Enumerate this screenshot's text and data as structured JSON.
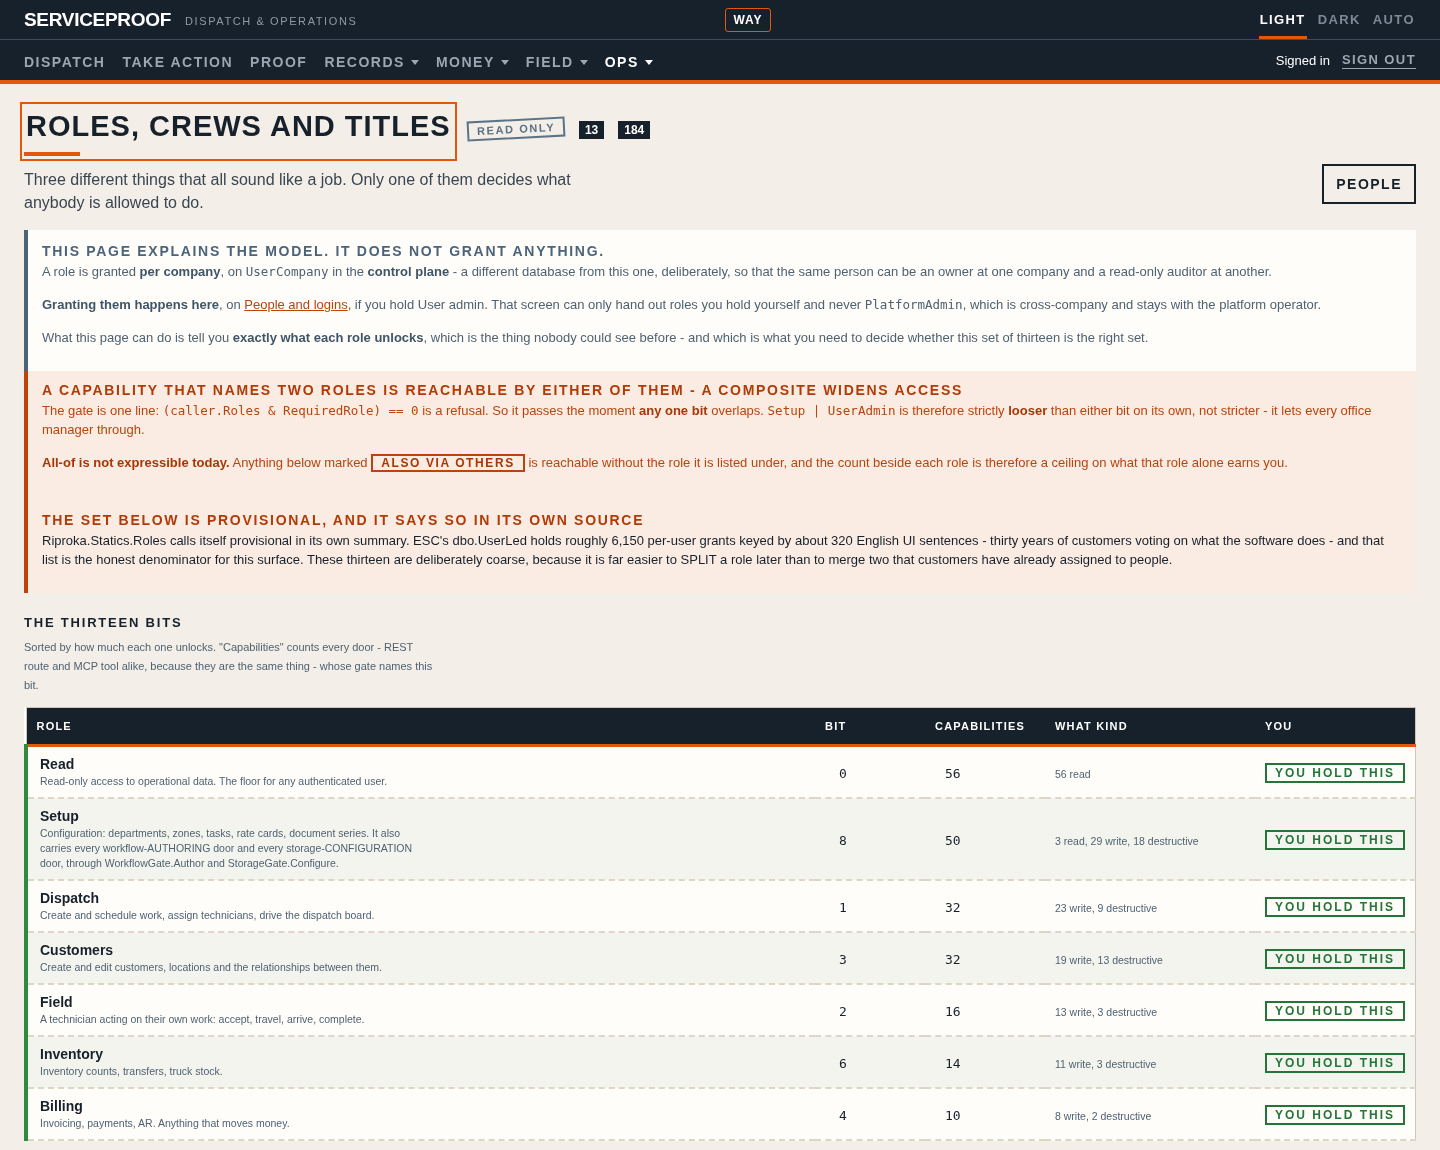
{
  "header": {
    "brand": "SERVICEPROOF",
    "tagline": "DISPATCH & OPERATIONS",
    "badge": "WAY",
    "themes": [
      {
        "label": "LIGHT",
        "selected": true
      },
      {
        "label": "DARK",
        "selected": false
      },
      {
        "label": "AUTO",
        "selected": false
      }
    ]
  },
  "nav": {
    "items": [
      {
        "label": "DISPATCH",
        "has_menu": false,
        "selected": false
      },
      {
        "label": "TAKE ACTION",
        "has_menu": false,
        "selected": false
      },
      {
        "label": "PROOF",
        "has_menu": false,
        "selected": false
      },
      {
        "label": "RECORDS",
        "has_menu": true,
        "selected": false
      },
      {
        "label": "MONEY",
        "has_menu": true,
        "selected": false
      },
      {
        "label": "FIELD",
        "has_menu": true,
        "selected": false
      },
      {
        "label": "OPS",
        "has_menu": true,
        "selected": true
      }
    ],
    "signed_in": "Signed in",
    "sign_out": "SIGN OUT"
  },
  "page": {
    "title": "ROLES, CREWS AND TITLES",
    "tag": "READ ONLY",
    "counts": [
      "13",
      "184"
    ],
    "subtitle": "Three different things that all sound like a job. Only one of them decides what anybody is allowed to do.",
    "button": "PEOPLE"
  },
  "notices": [
    {
      "kind": "info",
      "heading": "THIS PAGE EXPLAINS THE MODEL. IT DOES NOT GRANT ANYTHING.",
      "paragraphs": [
        [
          {
            "kind": "text",
            "text": "A role is granted **per company**, on "
          },
          {
            "kind": "code",
            "text": "UserCompany"
          },
          {
            "kind": "text",
            "text": " in the **control plane** - a different database from this one, deliberately, so that the same person can be an owner at one company and a read-only auditor at another."
          }
        ],
        [
          {
            "kind": "text",
            "text": "**Granting them happens here**, on "
          },
          {
            "kind": "link",
            "text": "People and logins"
          },
          {
            "kind": "text",
            "text": ", if you hold User admin. That screen can only hand out roles you hold yourself and never "
          },
          {
            "kind": "code",
            "text": "PlatformAdmin"
          },
          {
            "kind": "text",
            "text": ", which is cross-company and stays with the platform operator."
          }
        ],
        [
          {
            "kind": "text",
            "text": "What this page can do is tell you **exactly what each role unlocks**, which is the thing nobody could see before - and which is what you need to decide whether this set of thirteen is the right set."
          }
        ]
      ]
    },
    {
      "kind": "warning",
      "heading": "A CAPABILITY THAT NAMES TWO ROLES IS REACHABLE BY EITHER OF THEM - A COMPOSITE WIDENS ACCESS",
      "paragraphs": [
        [
          {
            "kind": "text",
            "text": "The gate is one line: "
          },
          {
            "kind": "code",
            "text": "(caller.Roles & RequiredRole) == 0"
          },
          {
            "kind": "text",
            "text": " is a refusal. So it passes the moment **any one bit** overlaps. "
          },
          {
            "kind": "code",
            "text": "Setup | UserAdmin"
          },
          {
            "kind": "text",
            "text": " is therefore strictly **looser** than either bit on its own, not stricter - it lets every office manager through."
          }
        ],
        [
          {
            "kind": "text",
            "text": "**All-of is not expressible today.** Anything below marked "
          },
          {
            "kind": "badge",
            "text": "ALSO VIA OTHERS"
          },
          {
            "kind": "text",
            "text": " is reachable without the role it is listed under, and the count beside each role is therefore a ceiling on what that role alone earns you."
          }
        ]
      ]
    },
    {
      "kind": "warning",
      "heading": "THE SET BELOW IS PROVISIONAL, AND IT SAYS SO IN ITS OWN SOURCE",
      "paragraphs": [
        [
          {
            "kind": "plain",
            "text": "Riproka.Statics.Roles calls itself provisional in its own summary. ESC's dbo.UserLed holds roughly 6,150 per-user grants keyed by about 320 English UI sentences - thirty years of customers voting on what the software does - and that list is the honest denominator for this surface. These thirteen are deliberately coarse, because it is far easier to SPLIT a role later than to merge two that customers have already assigned to people."
          }
        ]
      ]
    }
  ],
  "section": {
    "title": "THE THIRTEEN BITS",
    "intro": "Sorted by how much each one unlocks. \"Capabilities\" counts every door - REST route and MCP tool alike, because they are the same thing - whose gate names this bit."
  },
  "table": {
    "columns": [
      "ROLE",
      "BIT",
      "CAPABILITIES",
      "WHAT KIND",
      "YOU"
    ],
    "rows": [
      {
        "name": "Read",
        "description": "Read-only access to operational data. The floor for any authenticated user.",
        "bit": "0",
        "capabilities": "56",
        "what_kind": "56 read",
        "you": "YOU HOLD THIS",
        "held": true
      },
      {
        "name": "Setup",
        "description": "Configuration: departments, zones, tasks, rate cards, document series. It also carries every workflow-AUTHORING door and every storage-CONFIGURATION door, through WorkflowGate.Author and StorageGate.Configure.",
        "bit": "8",
        "capabilities": "50",
        "what_kind": "3 read, 29 write, 18 destructive",
        "you": "YOU HOLD THIS",
        "held": true
      },
      {
        "name": "Dispatch",
        "description": "Create and schedule work, assign technicians, drive the dispatch board.",
        "bit": "1",
        "capabilities": "32",
        "what_kind": "23 write, 9 destructive",
        "you": "YOU HOLD THIS",
        "held": true
      },
      {
        "name": "Customers",
        "description": "Create and edit customers, locations and the relationships between them.",
        "bit": "3",
        "capabilities": "32",
        "what_kind": "19 write, 13 destructive",
        "you": "YOU HOLD THIS",
        "held": true
      },
      {
        "name": "Field",
        "description": "A technician acting on their own work: accept, travel, arrive, complete.",
        "bit": "2",
        "capabilities": "16",
        "what_kind": "13 write, 3 destructive",
        "you": "YOU HOLD THIS",
        "held": true
      },
      {
        "name": "Inventory",
        "description": "Inventory counts, transfers, truck stock.",
        "bit": "6",
        "capabilities": "14",
        "what_kind": "11 write, 3 destructive",
        "you": "YOU HOLD THIS",
        "held": true
      },
      {
        "name": "Billing",
        "description": "Invoicing, payments, AR. Anything that moves money.",
        "bit": "4",
        "capabilities": "10",
        "what_kind": "8 write, 2 destructive",
        "you": "YOU HOLD THIS",
        "held": true
      }
    ]
  }
}
